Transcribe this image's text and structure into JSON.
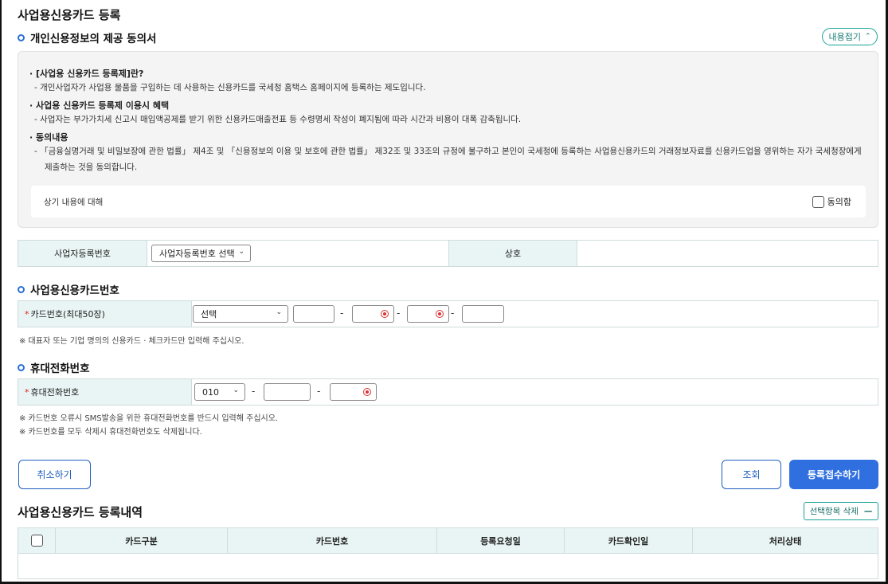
{
  "page_title": "사업용신용카드 등록",
  "consent": {
    "section_title": "개인신용정보의 제공 동의서",
    "collapse_label": "내용접기",
    "heading1": "· [사업용 신용카드 등록제]란?",
    "text1": "- 개인사업자가 사업용 물품을 구입하는 데 사용하는 신용카드를 국세청 홈택스 홈페이지에 등록하는 제도입니다.",
    "heading2": "· 사업용 신용카드 등록제 이용시 혜택",
    "text2": "- 사업자는 부가가치세 신고시 매입액공제를 받기 위한 신용카드매출전표 등 수령명세 작성이 폐지됨에 따라 시간과 비용이 대폭 감축됩니다.",
    "heading3": "· 동의내용",
    "text3a": "- 「금융실명거래 및 비밀보장에 관한 법률」 제4조 및 「신용정보의 이용 및 보호에 관한 법률」 제32조 및 33조의 규정에 불구하고 본인이 국세청에 등록하는 사업용신용카드의   거래정보자료를 신용카드업을 영위하는 자가 국세청장에게",
    "text3b": "제출하는 것을 동의합니다.",
    "agree_prompt": "상기 내용에 대해",
    "agree_label": "동의함"
  },
  "business": {
    "reg_no_label": "사업자등록번호",
    "reg_no_select": "사업자등록번호 선택",
    "company_label": "상호"
  },
  "card": {
    "section_title": "사업용신용카드번호",
    "label": "카드번호(최대50장)",
    "select_value": "선택",
    "note": "※ 대표자 또는 기업 명의의 신용카드 · 체크카드만 입력해 주십시오."
  },
  "phone": {
    "section_title": "휴대전화번호",
    "label": "휴대전화번호",
    "prefix_value": "010",
    "note1": "※ 카드번호 오류시 SMS발송을 위한 휴대전화번호를 반드시 입력해 주십시오.",
    "note2": "※ 카드번호를 모두 삭제시 휴대전화번호도 삭제됩니다."
  },
  "dash": "-",
  "required_mark": "*",
  "buttons": {
    "cancel": "취소하기",
    "search": "조회",
    "submit": "등록접수하기"
  },
  "history": {
    "title": "사업용신용카드 등록내역",
    "delete_label": "선택항목 삭제",
    "columns": [
      "카드구분",
      "카드번호",
      "등록요청일",
      "카드확인일",
      "처리상태"
    ]
  }
}
